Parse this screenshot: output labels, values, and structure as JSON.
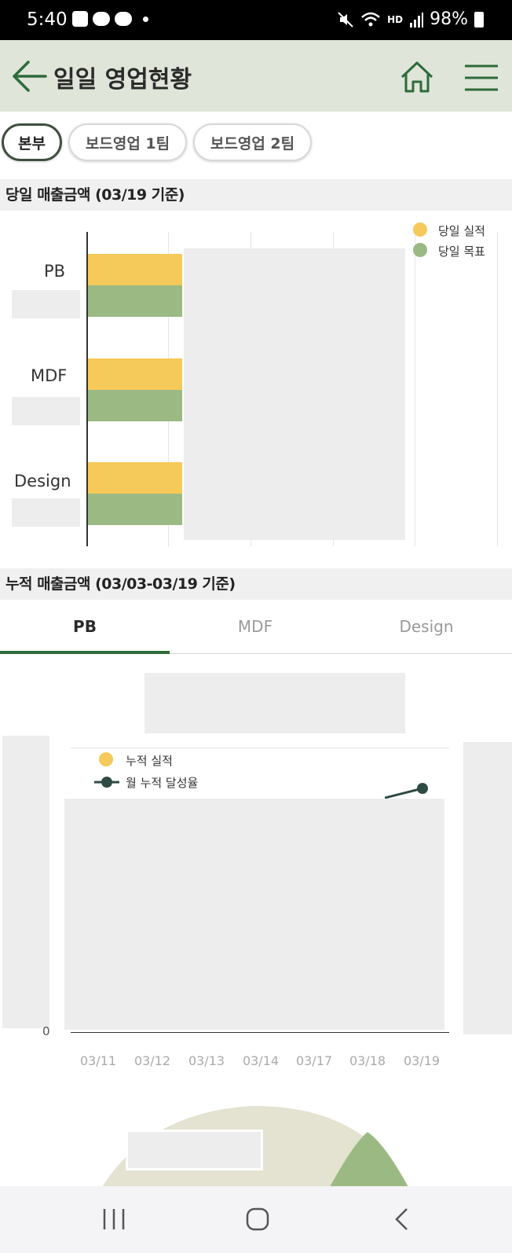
{
  "status_bar": {
    "time": "5:40",
    "battery": "98%",
    "icons": [
      "gallery-icon",
      "chat-icon",
      "talk-icon",
      "mute-icon",
      "wifi-icon",
      "hd-voice-icon",
      "signal-icon",
      "battery-icon"
    ],
    "hd_label": "HD"
  },
  "header": {
    "title": "일일 영업현황",
    "background": "#dfe5d9",
    "accent": "#2e6b3a"
  },
  "chips": [
    {
      "label": "본부",
      "active": true
    },
    {
      "label": "보드영업 1팀",
      "active": false
    },
    {
      "label": "보드영업 2팀",
      "active": false
    }
  ],
  "daily_section": {
    "title": "당일 매출금액 (03/19 기준)",
    "legend": [
      {
        "label": "당일 실적",
        "color": "#f5c95a"
      },
      {
        "label": "당일 목표",
        "color": "#9bba83"
      }
    ],
    "categories": [
      "PB",
      "MDF",
      "Design"
    ]
  },
  "cumulative_section": {
    "title": "누적 매출금액 (03/03-03/19 기준)",
    "tabs": [
      {
        "label": "PB",
        "active": true
      },
      {
        "label": "MDF",
        "active": false
      },
      {
        "label": "Design",
        "active": false
      }
    ],
    "legend": [
      {
        "label": "누적 실적",
        "color": "#f5c95a"
      },
      {
        "label": "월 누적 달성율",
        "color": "#2e4a44"
      }
    ],
    "x_labels": [
      "03/11",
      "03/12",
      "03/13",
      "03/14",
      "03/17",
      "03/18",
      "03/19"
    ],
    "y_zero": "0"
  },
  "chart_data": [
    {
      "type": "bar",
      "title": "당일 매출금액 (03/19 기준)",
      "categories": [
        "PB",
        "MDF",
        "Design"
      ],
      "series": [
        {
          "name": "당일 실적",
          "color": "#f5c95a"
        },
        {
          "name": "당일 목표",
          "color": "#9bba83"
        }
      ]
    },
    {
      "type": "line",
      "title": "누적 매출금액 (03/03-03/19 기준)",
      "x": [
        "03/11",
        "03/12",
        "03/13",
        "03/14",
        "03/17",
        "03/18",
        "03/19"
      ],
      "series": [
        {
          "name": "누적 실적",
          "color": "#f5c95a"
        },
        {
          "name": "월 누적 달성율",
          "color": "#2e4a44"
        }
      ]
    }
  ]
}
